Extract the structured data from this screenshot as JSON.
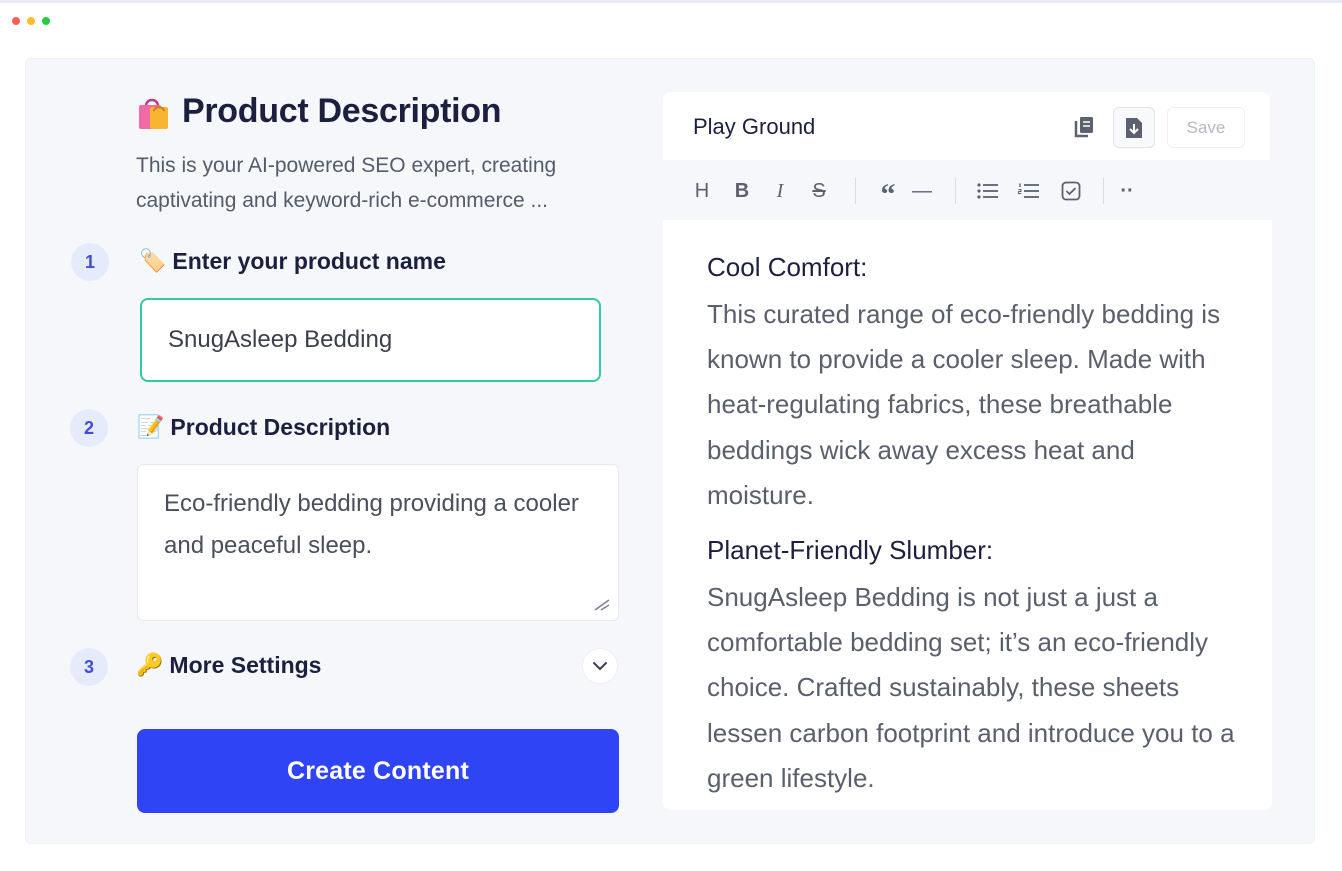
{
  "window": {
    "dots": [
      "#ff5f57",
      "#febc2e",
      "#28c840"
    ]
  },
  "header": {
    "title": "Product Description",
    "subtitle": "This is your AI-powered SEO expert, creating captivating and keyword-rich e-commerce ..."
  },
  "steps": [
    {
      "number": "1",
      "emoji": "🏷️",
      "label": "Enter your product name"
    },
    {
      "number": "2",
      "emoji": "📝",
      "label": "Product Description"
    },
    {
      "number": "3",
      "emoji": "🔑",
      "label": "More Settings"
    }
  ],
  "form": {
    "product_name_value": "SnugAsleep Bedding",
    "description_value": "Eco-friendly bedding providing a cooler and peaceful sleep.",
    "create_label": "Create Content"
  },
  "editor": {
    "title": "Play Ground",
    "save_label": "Save",
    "toolbar": {
      "heading": "H",
      "bold": "B",
      "italic": "I",
      "strike": "S",
      "quote": "“",
      "rule": "—",
      "more": "··"
    },
    "sections": [
      {
        "heading": "Cool Comfort:",
        "body": "This curated range of eco-friendly bedding is known to provide a cooler sleep. Made with heat-regulating fabrics, these breathable beddings wick away excess heat and moisture."
      },
      {
        "heading": "Planet-Friendly Slumber:",
        "body": "SnugAsleep Bedding is not just a just a comfortable bedding set; it’s an eco-friendly choice. Crafted sustainably, these sheets lessen carbon footprint and introduce you to a green lifestyle."
      }
    ]
  },
  "colors": {
    "accent": "#2f45f5",
    "input_focus": "#33c9a2",
    "title": "#1c1f3d"
  }
}
